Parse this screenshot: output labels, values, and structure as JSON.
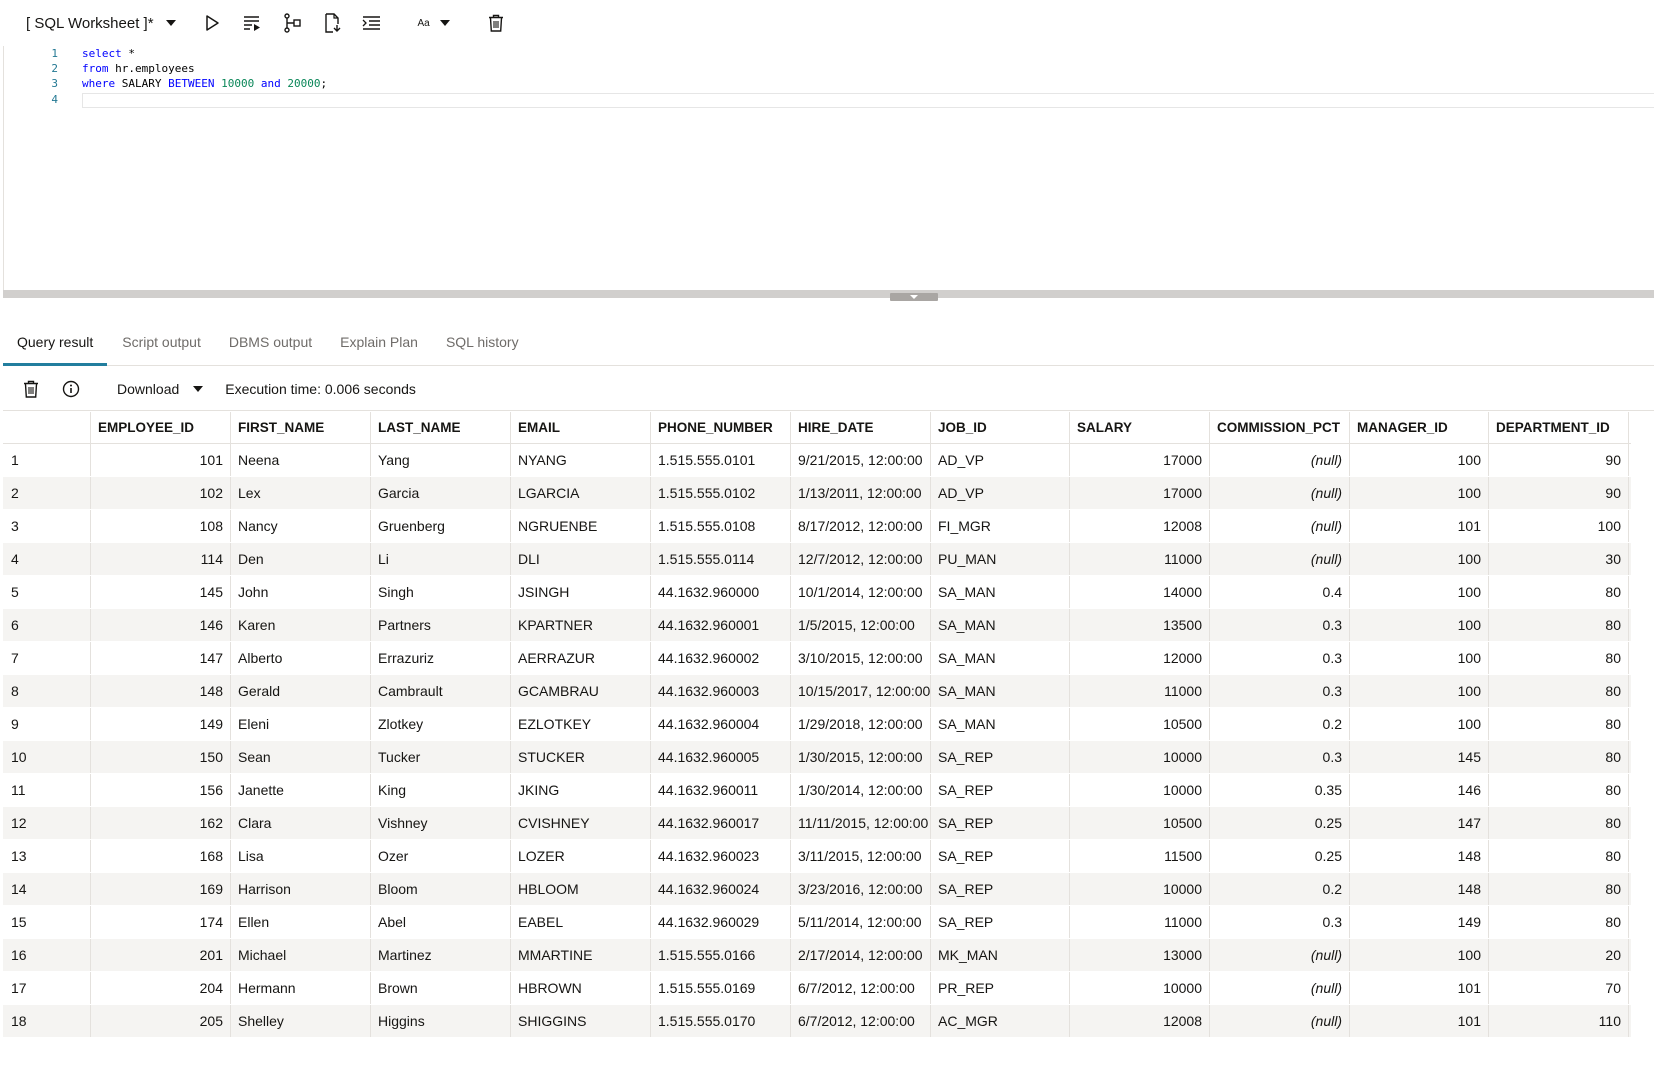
{
  "toolbar": {
    "worksheet_title": "[ SQL Worksheet ]*",
    "font_button_label": "Aa",
    "icons": [
      "run-statement-icon",
      "run-script-icon",
      "explain-plan-icon",
      "autotrace-icon",
      "format-icon",
      "font-size-icon",
      "clear-icon"
    ]
  },
  "editor": {
    "lines": [
      {
        "n": "1"
      },
      {
        "n": "2"
      },
      {
        "n": "3"
      },
      {
        "n": "4"
      }
    ],
    "tokens": {
      "l1_select": "select",
      "l1_rest": " *",
      "l2_from": "from",
      "l2_rest": " hr.employees",
      "l3_where": "where",
      "l3_salary": " SALARY ",
      "l3_between": "BETWEEN",
      "l3_sp1": " ",
      "l3_n1": "10000",
      "l3_sp2": " ",
      "l3_and": "and",
      "l3_sp3": " ",
      "l3_n2": "20000",
      "l3_end": ";"
    }
  },
  "tabs": [
    {
      "label": "Query result",
      "active": true
    },
    {
      "label": "Script output"
    },
    {
      "label": "DBMS output"
    },
    {
      "label": "Explain Plan"
    },
    {
      "label": "SQL history"
    }
  ],
  "results_toolbar": {
    "download_label": "Download",
    "execution_time": "Execution time: 0.006 seconds"
  },
  "grid": {
    "columns": [
      "EMPLOYEE_ID",
      "FIRST_NAME",
      "LAST_NAME",
      "EMAIL",
      "PHONE_NUMBER",
      "HIRE_DATE",
      "JOB_ID",
      "SALARY",
      "COMMISSION_PCT",
      "MANAGER_ID",
      "DEPARTMENT_ID"
    ],
    "rows": [
      [
        "1",
        "101",
        "Neena",
        "Yang",
        "NYANG",
        "1.515.555.0101",
        "9/21/2015, 12:00:00",
        "AD_VP",
        "17000",
        "(null)",
        "100",
        "90"
      ],
      [
        "2",
        "102",
        "Lex",
        "Garcia",
        "LGARCIA",
        "1.515.555.0102",
        "1/13/2011, 12:00:00",
        "AD_VP",
        "17000",
        "(null)",
        "100",
        "90"
      ],
      [
        "3",
        "108",
        "Nancy",
        "Gruenberg",
        "NGRUENBE",
        "1.515.555.0108",
        "8/17/2012, 12:00:00",
        "FI_MGR",
        "12008",
        "(null)",
        "101",
        "100"
      ],
      [
        "4",
        "114",
        "Den",
        "Li",
        "DLI",
        "1.515.555.0114",
        "12/7/2012, 12:00:00",
        "PU_MAN",
        "11000",
        "(null)",
        "100",
        "30"
      ],
      [
        "5",
        "145",
        "John",
        "Singh",
        "JSINGH",
        "44.1632.960000",
        "10/1/2014, 12:00:00",
        "SA_MAN",
        "14000",
        "0.4",
        "100",
        "80"
      ],
      [
        "6",
        "146",
        "Karen",
        "Partners",
        "KPARTNER",
        "44.1632.960001",
        "1/5/2015, 12:00:00",
        "SA_MAN",
        "13500",
        "0.3",
        "100",
        "80"
      ],
      [
        "7",
        "147",
        "Alberto",
        "Errazuriz",
        "AERRAZUR",
        "44.1632.960002",
        "3/10/2015, 12:00:00",
        "SA_MAN",
        "12000",
        "0.3",
        "100",
        "80"
      ],
      [
        "8",
        "148",
        "Gerald",
        "Cambrault",
        "GCAMBRAU",
        "44.1632.960003",
        "10/15/2017, 12:00:00",
        "SA_MAN",
        "11000",
        "0.3",
        "100",
        "80"
      ],
      [
        "9",
        "149",
        "Eleni",
        "Zlotkey",
        "EZLOTKEY",
        "44.1632.960004",
        "1/29/2018, 12:00:00",
        "SA_MAN",
        "10500",
        "0.2",
        "100",
        "80"
      ],
      [
        "10",
        "150",
        "Sean",
        "Tucker",
        "STUCKER",
        "44.1632.960005",
        "1/30/2015, 12:00:00",
        "SA_REP",
        "10000",
        "0.3",
        "145",
        "80"
      ],
      [
        "11",
        "156",
        "Janette",
        "King",
        "JKING",
        "44.1632.960011",
        "1/30/2014, 12:00:00",
        "SA_REP",
        "10000",
        "0.35",
        "146",
        "80"
      ],
      [
        "12",
        "162",
        "Clara",
        "Vishney",
        "CVISHNEY",
        "44.1632.960017",
        "11/11/2015, 12:00:00",
        "SA_REP",
        "10500",
        "0.25",
        "147",
        "80"
      ],
      [
        "13",
        "168",
        "Lisa",
        "Ozer",
        "LOZER",
        "44.1632.960023",
        "3/11/2015, 12:00:00",
        "SA_REP",
        "11500",
        "0.25",
        "148",
        "80"
      ],
      [
        "14",
        "169",
        "Harrison",
        "Bloom",
        "HBLOOM",
        "44.1632.960024",
        "3/23/2016, 12:00:00",
        "SA_REP",
        "10000",
        "0.2",
        "148",
        "80"
      ],
      [
        "15",
        "174",
        "Ellen",
        "Abel",
        "EABEL",
        "44.1632.960029",
        "5/11/2014, 12:00:00",
        "SA_REP",
        "11000",
        "0.3",
        "149",
        "80"
      ],
      [
        "16",
        "201",
        "Michael",
        "Martinez",
        "MMARTINE",
        "1.515.555.0166",
        "2/17/2014, 12:00:00",
        "MK_MAN",
        "13000",
        "(null)",
        "100",
        "20"
      ],
      [
        "17",
        "204",
        "Hermann",
        "Brown",
        "HBROWN",
        "1.515.555.0169",
        "6/7/2012, 12:00:00",
        "PR_REP",
        "10000",
        "(null)",
        "101",
        "70"
      ],
      [
        "18",
        "205",
        "Shelley",
        "Higgins",
        "SHIGGINS",
        "1.515.555.0170",
        "6/7/2012, 12:00:00",
        "AC_MGR",
        "12008",
        "(null)",
        "101",
        "110"
      ]
    ]
  }
}
